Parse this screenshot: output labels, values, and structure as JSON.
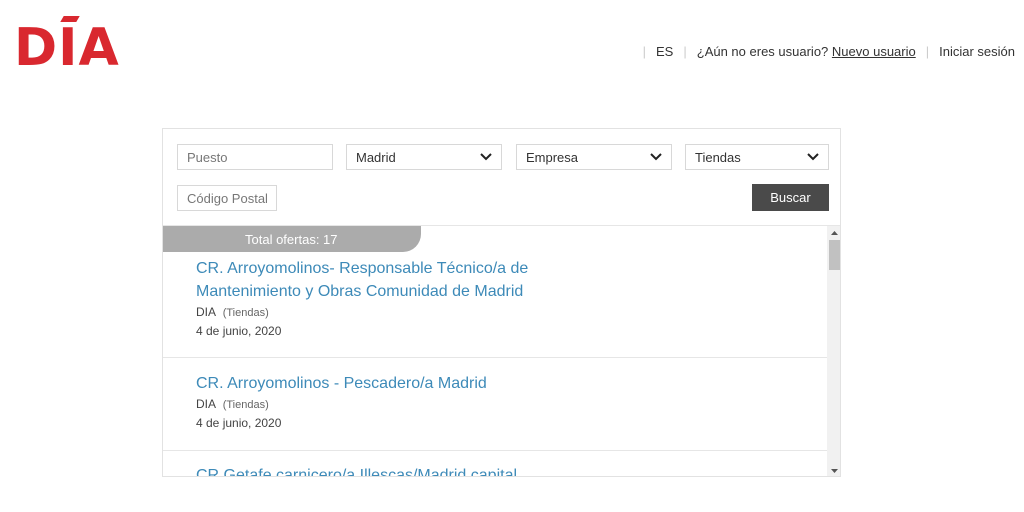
{
  "brand": {
    "logo_text": "DIA",
    "color": "#d9282f"
  },
  "header": {
    "language": "ES",
    "prompt": "¿Aún no eres usuario?",
    "new_user_link": "Nuevo usuario",
    "login": "Iniciar sesión"
  },
  "filters": {
    "position_placeholder": "Puesto",
    "location_value": "Madrid",
    "company_value": "Empresa",
    "type_value": "Tiendas",
    "postal_placeholder": "Código Postal",
    "search_label": "Buscar"
  },
  "results": {
    "total_label": "Total ofertas: 17",
    "jobs": [
      {
        "title": "CR. Arroyomolinos- Responsable Técnico/a de Mantenimiento y Obras Comunidad de Madrid",
        "company": "DIA",
        "category": "(Tiendas)",
        "date": "4 de junio, 2020"
      },
      {
        "title": "CR. Arroyomolinos - Pescadero/a Madrid",
        "company": "DIA",
        "category": "(Tiendas)",
        "date": "4 de junio, 2020"
      },
      {
        "title": "CR Getafe carnicero/a Illescas/Madrid capital",
        "company": "",
        "category": "",
        "date": ""
      }
    ]
  },
  "colors": {
    "accent_link": "#3d8ab8",
    "button_bg": "#4a4a4a",
    "tab_bg": "#ababab"
  },
  "icons": {
    "select_chevron": "chevron-down-icon",
    "scroll_up": "arrow-up-icon",
    "scroll_down": "arrow-down-icon"
  }
}
